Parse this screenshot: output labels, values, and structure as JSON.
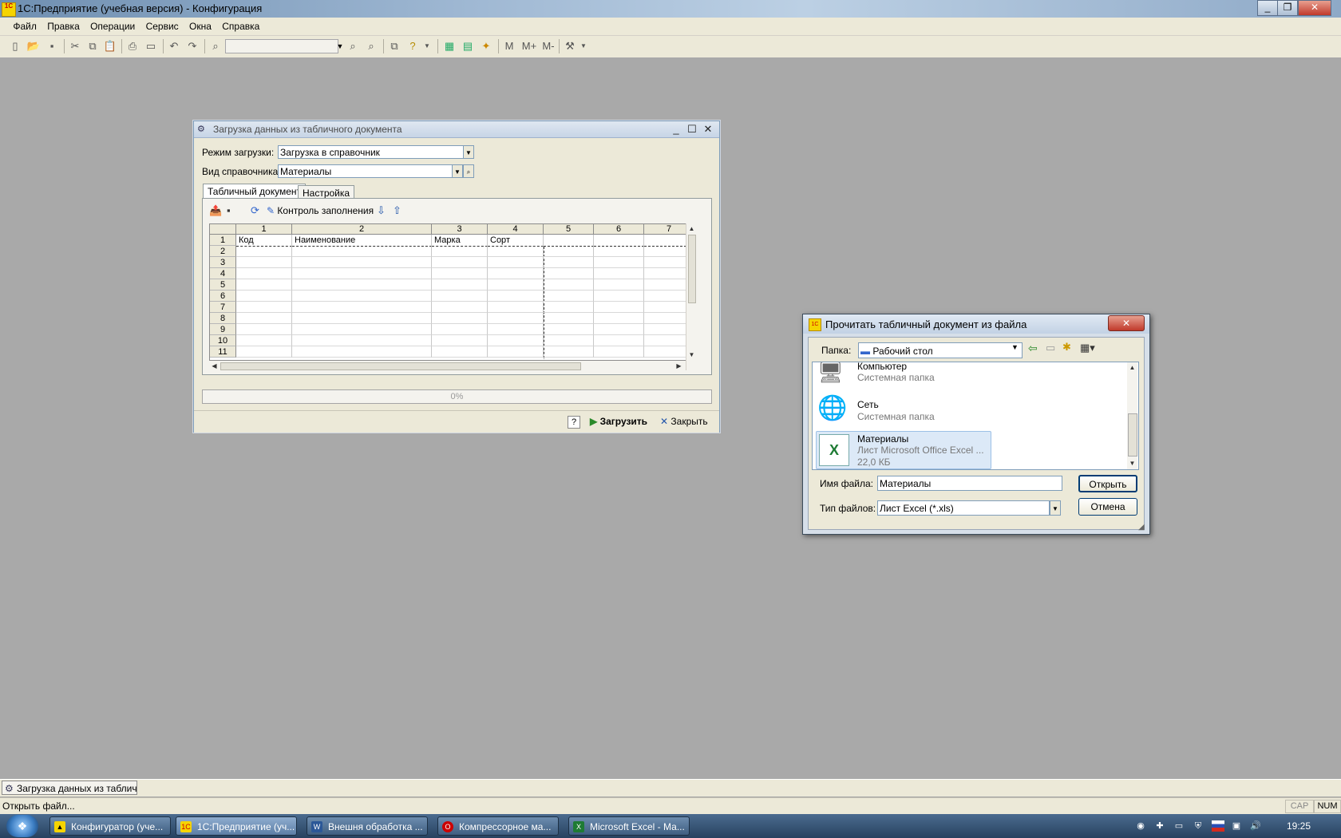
{
  "app": {
    "title": "1С:Предприятие (учебная версия) - Конфигурация",
    "logo": "1С"
  },
  "menu": [
    "Файл",
    "Правка",
    "Операции",
    "Сервис",
    "Окна",
    "Справка"
  ],
  "toolbar": {
    "memory": [
      "M",
      "M+",
      "M-"
    ]
  },
  "load_window": {
    "title": "Загрузка данных из табличного документа",
    "mode_label": "Режим загрузки:",
    "mode_value": "Загрузка в справочник",
    "ref_label": "Вид справочника:",
    "ref_value": "Материалы",
    "tabs": [
      "Табличный документ",
      "Настройка"
    ],
    "fill_control": "Контроль заполнения",
    "columns": [
      "1",
      "2",
      "3",
      "4",
      "5",
      "6",
      "7"
    ],
    "rows": [
      "1",
      "2",
      "3",
      "4",
      "5",
      "6",
      "7",
      "8",
      "9",
      "10",
      "11"
    ],
    "header_cells": [
      "Код",
      "Наименование",
      "Марка",
      "Сорт"
    ],
    "progress": "0%",
    "help": "?",
    "load_button": "Загрузить",
    "close_button": "Закрыть"
  },
  "open_dialog": {
    "title": "Прочитать табличный документ из файла",
    "folder_label": "Папка:",
    "folder_value": "Рабочий стол",
    "items": [
      {
        "name": "Компьютер",
        "desc": "Системная папка"
      },
      {
        "name": "Сеть",
        "desc": "Системная папка"
      },
      {
        "name": "Материалы",
        "desc": "Лист Microsoft Office Excel ...",
        "size": "22,0 КБ"
      }
    ],
    "filename_label": "Имя файла:",
    "filename_value": "Материалы",
    "filetype_label": "Тип файлов:",
    "filetype_value": "Лист Excel (*.xls)",
    "open_button": "Открыть",
    "cancel_button": "Отмена"
  },
  "window_bar": {
    "item": "Загрузка данных из таблич..."
  },
  "status": {
    "text": "Открыть файл...",
    "cap": "CAP",
    "num": "NUM"
  },
  "taskbar": {
    "tasks": [
      "Конфигуратор (уче...",
      "1С:Предприятие (уч...",
      "Внешня обработка ...",
      "Компрессорное ма...",
      "Microsoft Excel - Ма..."
    ],
    "clock": "19:25"
  }
}
